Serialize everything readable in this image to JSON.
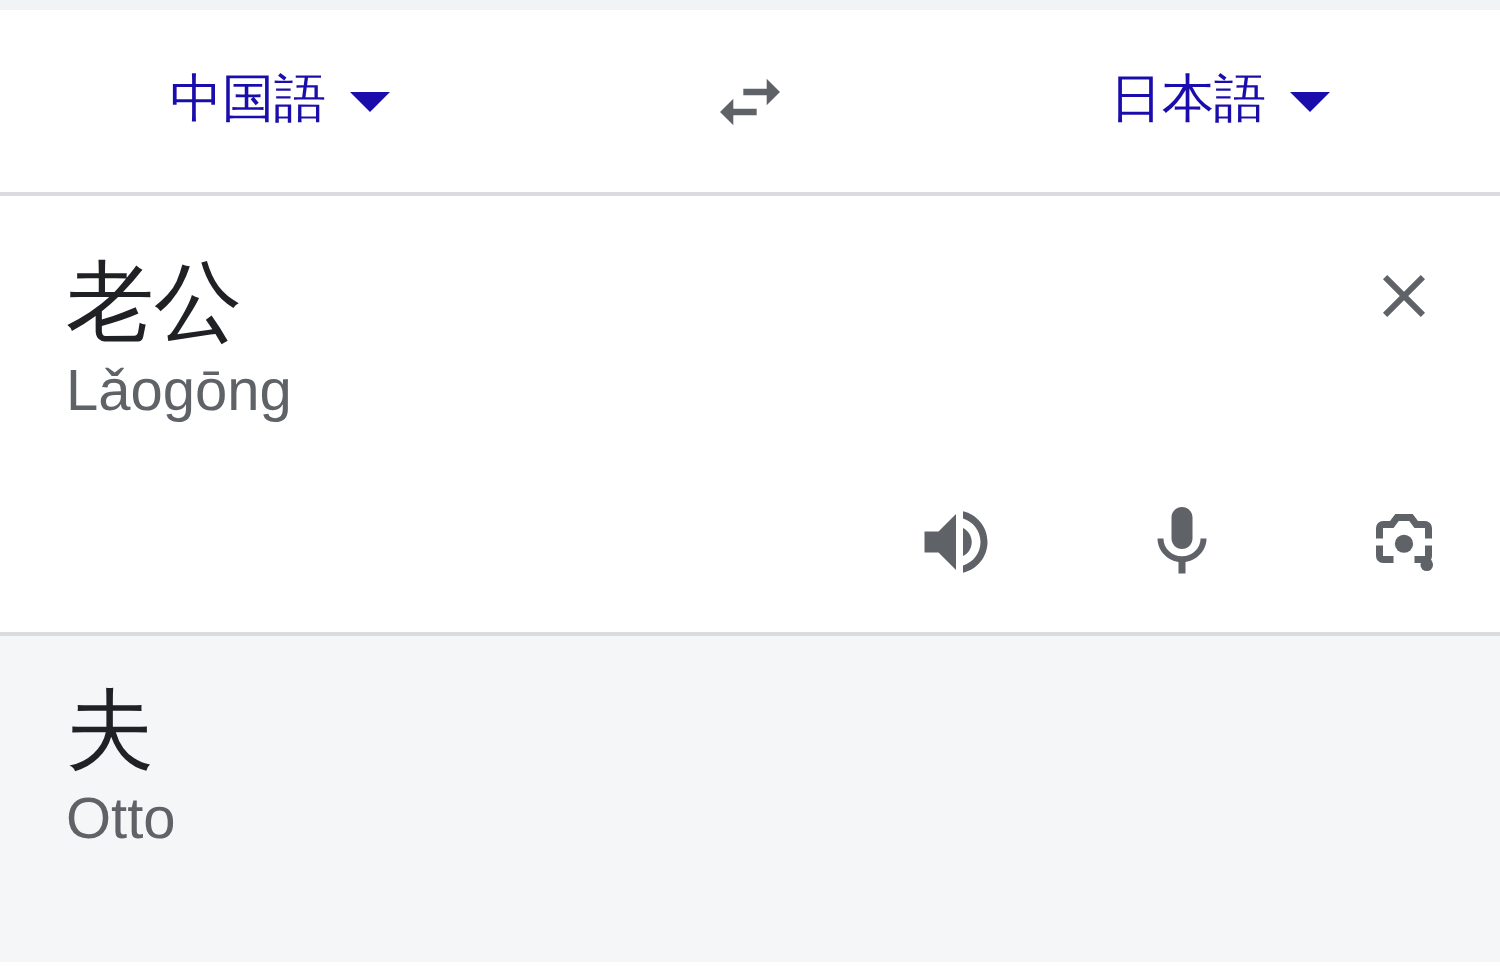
{
  "language_bar": {
    "source_language": "中国語",
    "target_language": "日本語"
  },
  "input": {
    "text": "老公",
    "romanization": "Lǎogōng"
  },
  "output": {
    "text": "夫",
    "romanization": "Otto"
  }
}
